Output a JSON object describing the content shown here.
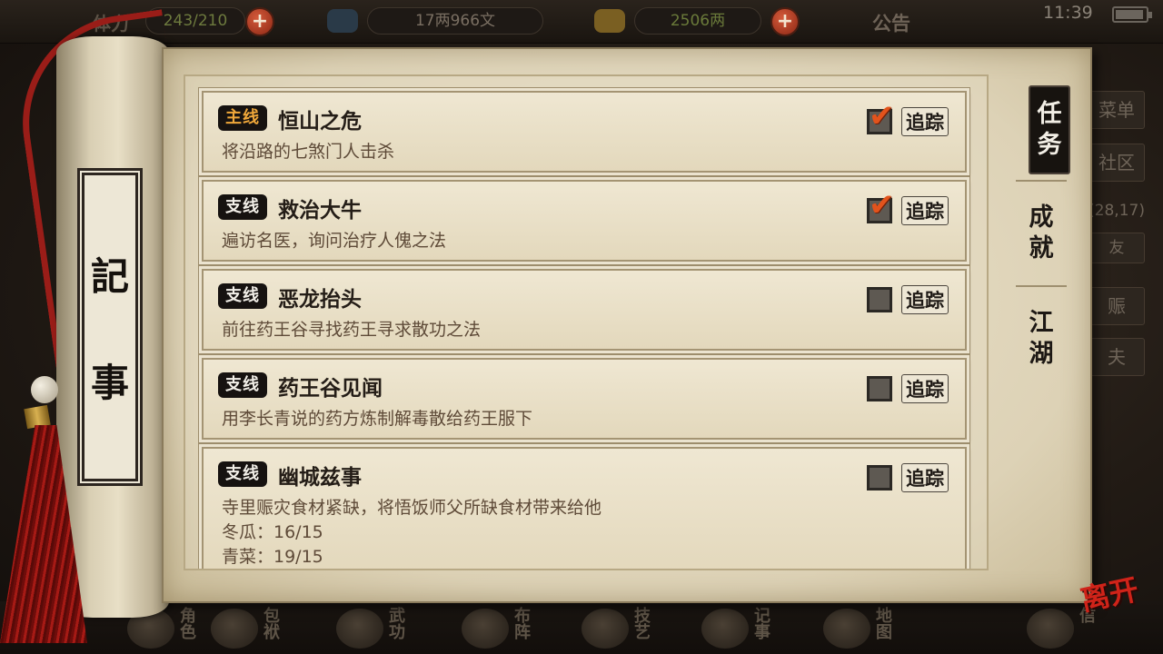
{
  "hud": {
    "stamina_label": "体力",
    "stamina_value": "243/210",
    "copper_value": "17两966文",
    "silver_value": "2506两",
    "notice_label": "公告",
    "time": "11:39",
    "plus_symbol": "+"
  },
  "side_menu": {
    "menu_label": "菜单",
    "community_label": "社区",
    "coords": "(28,17)",
    "item3": "友",
    "item4": "赈",
    "item5": "夫"
  },
  "bottom_nav": [
    {
      "label": "角色"
    },
    {
      "label": "包袱"
    },
    {
      "label": "武功"
    },
    {
      "label": "布阵"
    },
    {
      "label": "技艺"
    },
    {
      "label": "记事"
    },
    {
      "label": "地图"
    },
    {
      "label": "信"
    }
  ],
  "scroll": {
    "title_char_1": "記",
    "title_char_2": "事"
  },
  "quests": [
    {
      "type": "主线",
      "type_kind": "main",
      "title": "恒山之危",
      "desc": "将沿路的七煞门人击杀",
      "tracked": true,
      "track_label": "追踪"
    },
    {
      "type": "支线",
      "type_kind": "side",
      "title": "救治大牛",
      "desc": "遍访名医，询问治疗人傀之法",
      "tracked": true,
      "track_label": "追踪"
    },
    {
      "type": "支线",
      "type_kind": "side",
      "title": "恶龙抬头",
      "desc": "前往药王谷寻找药王寻求散功之法",
      "tracked": false,
      "track_label": "追踪"
    },
    {
      "type": "支线",
      "type_kind": "side",
      "title": "药王谷见闻",
      "desc": "用李长青说的药方炼制解毒散给药王服下",
      "tracked": false,
      "track_label": "追踪"
    },
    {
      "type": "支线",
      "type_kind": "side",
      "title": "幽城兹事",
      "desc": "寺里赈灾食材紧缺，将悟饭师父所缺食材带来给他",
      "tracked": false,
      "track_label": "追踪",
      "progress": [
        "冬瓜：16/15",
        "青菜：19/15"
      ]
    }
  ],
  "tabs": [
    {
      "label": "任务",
      "active": true
    },
    {
      "label": "成就",
      "active": false
    },
    {
      "label": "江湖",
      "active": false
    }
  ],
  "exit_label": "离开",
  "checkmark": "✔",
  "colors": {
    "main_quest_tag": "#f0a83a",
    "check_mark": "#e2531c",
    "exit_red": "#cf2319",
    "paper": "#ece4cf"
  }
}
